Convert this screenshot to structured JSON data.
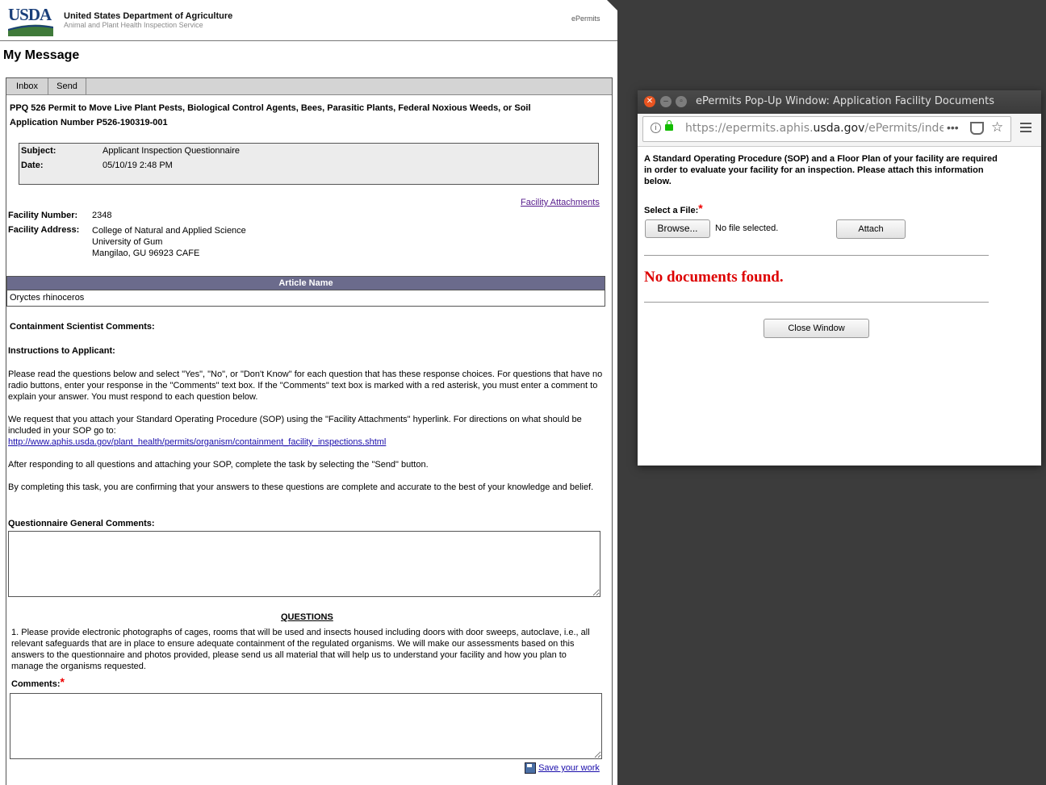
{
  "header": {
    "logo_text": "USDA",
    "department": "United States Department of Agriculture",
    "agency": "Animal and Plant Health Inspection Service",
    "app_name": "ePermits"
  },
  "page": {
    "title": "My Message"
  },
  "tabs": [
    {
      "label": "Inbox"
    },
    {
      "label": "Send"
    }
  ],
  "message": {
    "permit_title": "PPQ 526 Permit to Move Live Plant Pests, Biological Control Agents, Bees, Parasitic Plants, Federal Noxious Weeds, or Soil",
    "application_number": "Application Number P526-190319-001",
    "subject_label": "Subject:",
    "subject_value": "Applicant Inspection Questionnaire",
    "date_label": "Date:",
    "date_value": "05/10/19 2:48 PM",
    "facility_attachments_link": "Facility Attachments",
    "facility_number_label": "Facility Number:",
    "facility_number_value": "2348",
    "facility_address_label": "Facility Address:",
    "facility_address_lines": [
      "College of Natural and Applied Science",
      "University of Gum",
      "Mangilao, GU 96923 CAFE"
    ]
  },
  "article_table": {
    "header": "Article Name",
    "rows": [
      "Oryctes rhinoceros"
    ]
  },
  "instructions": {
    "scientist_comments_label": "Containment Scientist Comments:",
    "instructions_label": "Instructions to Applicant:",
    "para1": "Please read the questions below and select \"Yes\", \"No\", or \"Don't Know\" for each question that has these response choices. For questions that have no radio buttons, enter your response in the \"Comments\" text box. If the \"Comments\" text box is marked with a red asterisk, you must enter a comment to explain your answer. You must respond to each question below.",
    "para2": "We request that you attach your Standard Operating Procedure (SOP) using the \"Facility Attachments\" hyperlink. For directions on what should be included in your SOP go to:",
    "sop_link": "http://www.aphis.usda.gov/plant_health/permits/organism/containment_facility_inspections.shtml",
    "para3": "After responding to all questions and attaching your SOP, complete the task by selecting the \"Send\" button.",
    "para4": "By completing this task, you are confirming that your answers to these questions are complete and accurate to the best of your knowledge and belief."
  },
  "questionnaire": {
    "general_comments_label": "Questionnaire General Comments:",
    "general_comments_value": "",
    "questions_heading": "QUESTIONS",
    "question1": "1. Please provide electronic photographs of cages, rooms that will be used and insects housed including doors with door sweeps, autoclave, i.e., all relevant safeguards that are in place to ensure adequate containment of the regulated organisms. We will make our assessments based on this answers to the questionnaire and photos provided, please send us all material that will help us to understand your facility and how you plan to manage the organisms requested.",
    "comments_label": "Comments:",
    "required_marker": "*",
    "comments_value": "",
    "save_link": "Save your work"
  },
  "popup": {
    "window_title": "ePermits Pop-Up Window: Application Facility Documents",
    "url_prefix": "https://epermits.aphis.",
    "url_host": "usda.gov",
    "url_suffix": "/ePermits/index",
    "instructions": "A Standard Operating Procedure (SOP) and a Floor Plan of your facility are required in order to evaluate your facility for an inspection. Please attach this information below.",
    "select_file_label": "Select a File:",
    "required_marker": "*",
    "browse_label": "Browse...",
    "no_file_text": "No file selected.",
    "attach_label": "Attach",
    "no_documents_text": "No documents found.",
    "close_label": "Close Window"
  },
  "colors": {
    "usda_blue": "#1a3f7a",
    "usda_green": "#3f7a3a",
    "table_header": "#6b6b8c",
    "required_red": "#e00000",
    "no_docs_red": "#dd0000",
    "desktop_bg": "#3c3c3c"
  }
}
